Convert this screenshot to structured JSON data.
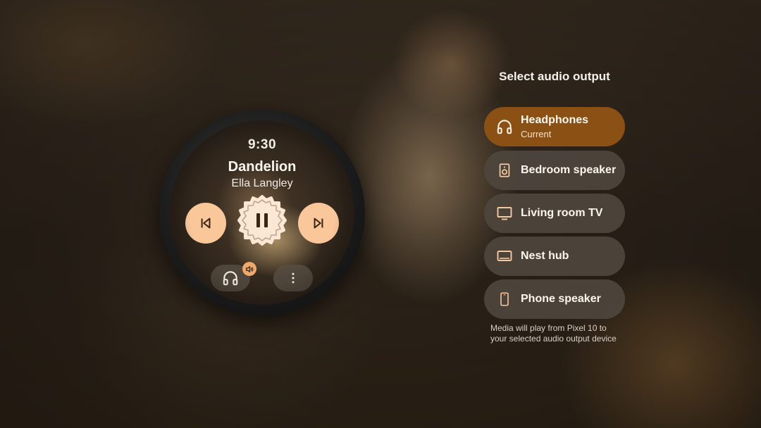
{
  "watch": {
    "time": "9:30",
    "track": {
      "title": "Dandelion",
      "artist": "Ella Langley"
    },
    "controls": {
      "previous_icon": "skip-previous-icon",
      "play_pause_icon": "pause-icon",
      "next_icon": "skip-next-icon",
      "output_icon": "headphones-icon",
      "volume_badge_icon": "volume-icon",
      "more_icon": "more-vert-icon"
    }
  },
  "output_panel": {
    "title": "Select audio output",
    "devices": [
      {
        "name": "Headphones",
        "subtitle": "Current",
        "icon": "headphones-icon",
        "selected": true
      },
      {
        "name": "Bedroom speaker",
        "icon": "speaker-icon",
        "selected": false
      },
      {
        "name": "Living room TV",
        "icon": "tv-icon",
        "selected": false
      },
      {
        "name": "Nest hub",
        "icon": "display-icon",
        "selected": false
      },
      {
        "name": "Phone speaker",
        "icon": "phone-icon",
        "selected": false
      }
    ],
    "note": "Media will play from Pixel 10 to your selected audio output device"
  },
  "colors": {
    "accent": "#fac79b",
    "selected_device": "#8a5014",
    "device_pill": "#4e463e",
    "badge": "#f0a96a"
  }
}
